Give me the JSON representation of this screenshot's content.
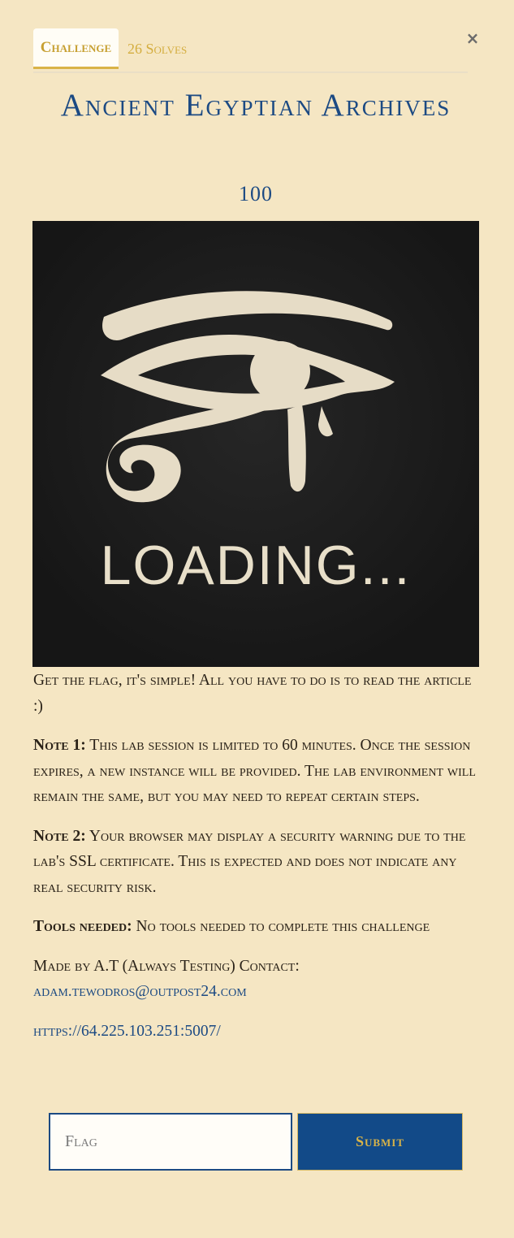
{
  "tabs": {
    "challenge_label": "Challenge",
    "solves_label": "26 Solves"
  },
  "close_label": "×",
  "challenge": {
    "title": "Ancient Egyptian Archives",
    "points": "100",
    "banner_text": "LOADING..."
  },
  "description": {
    "intro": "Get the flag, it's simple! All you have to do is to read the article :)",
    "note1_label": "Note 1:",
    "note1_text": " This lab session is limited to 60 minutes. Once the session expires, a new instance will be provided. The lab environment will remain the same, but you may need to repeat certain steps.",
    "note2_label": "Note 2:",
    "note2_text": " Your browser may display a security warning due to the lab's SSL certificate. This is expected and does not indicate any real security risk.",
    "tools_label": "Tools needed:",
    "tools_text": " No tools needed to complete this challenge",
    "made_by": "Made by A.T (Always Testing) Contact:",
    "contact_email": "adam.tewodros@outpost24.com",
    "link": "https://64.225.103.251:5007/"
  },
  "form": {
    "flag_placeholder": "Flag",
    "submit_label": "Submit"
  },
  "colors": {
    "accent_blue": "#1c4a83",
    "gold": "#d9b347",
    "background": "#f5e6c3"
  }
}
